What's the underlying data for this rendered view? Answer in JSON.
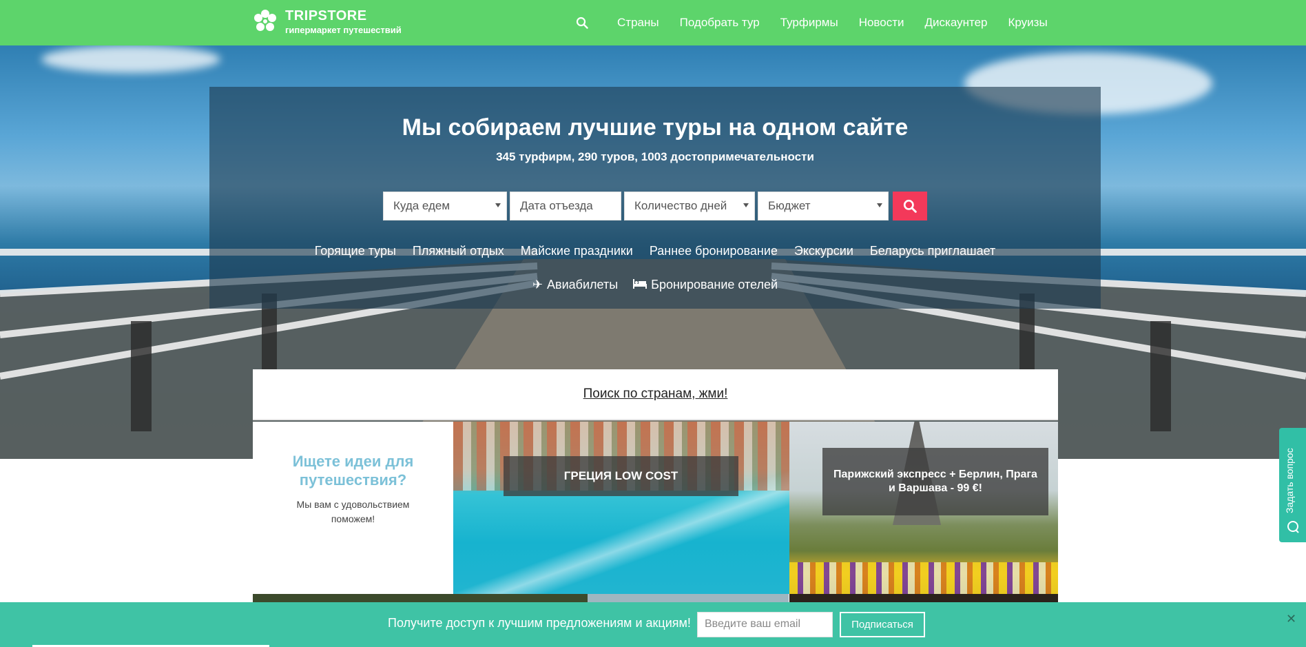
{
  "header": {
    "logo_title": "TRIPSTORE",
    "logo_subtitle": "гипермаркет путешествий",
    "nav": [
      "Страны",
      "Подобрать тур",
      "Турфирмы",
      "Новости",
      "Дискаунтер",
      "Круизы"
    ]
  },
  "hero": {
    "title": "Мы собираем лучшие туры на одном сайте",
    "stats": "345 турфирм,  290 туров,  1003 достопримечательности",
    "search": {
      "destination_placeholder": "Куда едем",
      "date_placeholder": "Дата отъезда",
      "days_placeholder": "Количество дней",
      "budget_placeholder": "Бюджет"
    },
    "tags": [
      "Горящие туры",
      "Пляжный отдых",
      "Майские праздники",
      "Раннее бронирование",
      "Экскурсии",
      "Беларусь приглашает"
    ],
    "links": {
      "flights": "Авиабилеты",
      "hotels": "Бронирование отелей"
    }
  },
  "content": {
    "country_search": "Поиск по странам, жми!",
    "ideas_title": "Ищете идеи для путешествия?",
    "ideas_text": "Мы вам с удовольствием поможем!",
    "tile_greece": "ГРЕЦИЯ LOW COST",
    "tile_paris": "Парижский экспресс + Берлин, Прага и Варшава - 99 €!"
  },
  "side_tab": {
    "label": "Задать вопрос"
  },
  "subscribe": {
    "text": "Получите доступ к лучшим предложениям и акциям!",
    "email_placeholder": "Введите ваш email",
    "button": "Подписаться",
    "close": "✕"
  },
  "colors": {
    "header": "#5dd46b",
    "accent": "#f3395a",
    "subscribe_bar": "#3fc3a5",
    "ideas_title": "#7cc1d8"
  }
}
